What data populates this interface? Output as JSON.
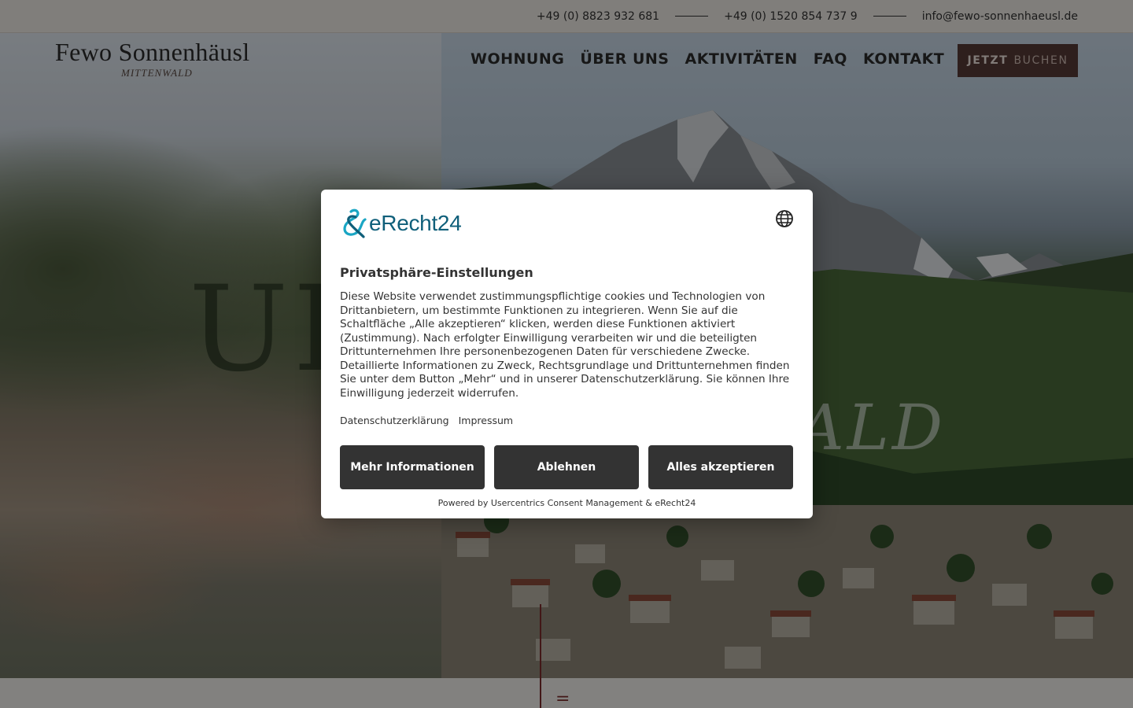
{
  "topbar": {
    "phone_1": "+49 (0) 8823 932 681",
    "phone_2": "+49 (0) 1520 854 737 9",
    "email": "info@fewo-sonnenhaeusl.de"
  },
  "header": {
    "logo_name": "Fewo Sonnenhäusl",
    "logo_sub": "MITTENWALD",
    "nav": [
      "WOHNUNG",
      "ÜBER UNS",
      "AKTIVITÄTEN",
      "FAQ",
      "KONTAKT"
    ],
    "cta_bold": "JETZT",
    "cta_rest": "BUCHEN"
  },
  "hero": {
    "big_left": "UI",
    "big_right": "ALD"
  },
  "bottom": {
    "mark": "="
  },
  "consent": {
    "brand": "eRecht24",
    "title": "Privatsphäre-Einstellungen",
    "text": "Diese Website verwendet zustimmungspflichtige cookies und Technologien von Drittanbietern, um bestimmte Funktionen zu integrieren. Wenn Sie auf die Schaltfläche „Alle akzeptieren“ klicken, werden diese Funktionen aktiviert (Zustimmung). Nach erfolgter Einwilligung verarbeiten wir und die beteiligten Drittunternehmen Ihre personenbezogenen Daten für verschiedene Zwecke. Detaillierte Informationen zu Zweck, Rechtsgrundlage und Drittunternehmen finden Sie unter dem Button „Mehr“ und in unserer Datenschutzerklärung. Sie können Ihre Einwilligung jederzeit widerrufen.",
    "link_privacy": "Datenschutzerklärung",
    "link_imprint": "Impressum",
    "btn_more": "Mehr Informationen",
    "btn_deny": "Ablehnen",
    "btn_accept": "Alles akzeptieren",
    "powered": "Powered by Usercentrics Consent Management & eRecht24",
    "icons": {
      "language": "globe-icon",
      "brand": "erecht24-logo-icon"
    },
    "colors": {
      "button": "#333333",
      "brand": "#0f5f7a"
    }
  }
}
